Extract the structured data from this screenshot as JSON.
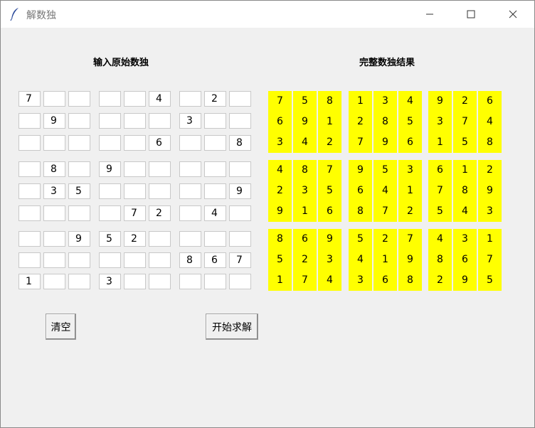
{
  "window": {
    "title": "解数独",
    "icon": "feather-icon",
    "controls": [
      "minimize-icon",
      "maximize-icon",
      "close-icon"
    ]
  },
  "labels": {
    "input": "输入原始数独",
    "result": "完整数独结果"
  },
  "input_grid": [
    [
      "7",
      "",
      "",
      "",
      "",
      "4",
      "",
      "2",
      ""
    ],
    [
      "",
      "9",
      "",
      "",
      "",
      "",
      "3",
      "",
      ""
    ],
    [
      "",
      "",
      "",
      "",
      "",
      "6",
      "",
      "",
      "8"
    ],
    [
      "",
      "8",
      "",
      "9",
      "",
      "",
      "",
      "",
      ""
    ],
    [
      "",
      "3",
      "5",
      "",
      "",
      "",
      "",
      "",
      "9"
    ],
    [
      "",
      "",
      "",
      "",
      "7",
      "2",
      "",
      "4",
      ""
    ],
    [
      "",
      "",
      "9",
      "5",
      "2",
      "",
      "",
      "",
      ""
    ],
    [
      "",
      "",
      "",
      "",
      "",
      "",
      "8",
      "6",
      "7"
    ],
    [
      "1",
      "",
      "",
      "3",
      "",
      "",
      "",
      "",
      ""
    ]
  ],
  "result_grid": [
    [
      "7",
      "5",
      "8",
      "1",
      "3",
      "4",
      "9",
      "2",
      "6"
    ],
    [
      "6",
      "9",
      "1",
      "2",
      "8",
      "5",
      "3",
      "7",
      "4"
    ],
    [
      "3",
      "4",
      "2",
      "7",
      "9",
      "6",
      "1",
      "5",
      "8"
    ],
    [
      "4",
      "8",
      "7",
      "9",
      "5",
      "3",
      "6",
      "1",
      "2"
    ],
    [
      "2",
      "3",
      "5",
      "6",
      "4",
      "1",
      "7",
      "8",
      "9"
    ],
    [
      "9",
      "1",
      "6",
      "8",
      "7",
      "2",
      "5",
      "4",
      "3"
    ],
    [
      "8",
      "6",
      "9",
      "5",
      "2",
      "7",
      "4",
      "3",
      "1"
    ],
    [
      "5",
      "2",
      "3",
      "4",
      "1",
      "9",
      "8",
      "6",
      "7"
    ],
    [
      "1",
      "7",
      "4",
      "3",
      "6",
      "8",
      "2",
      "9",
      "5"
    ]
  ],
  "buttons": {
    "clear": "清空",
    "solve": "开始求解"
  },
  "colors": {
    "result_background": "#ffff00",
    "window_background": "#f0f0f0"
  }
}
